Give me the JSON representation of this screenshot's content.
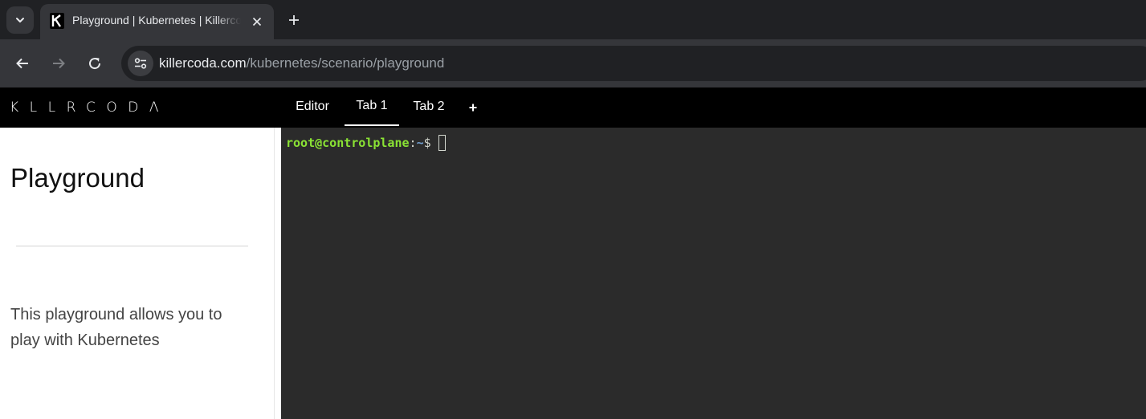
{
  "browser": {
    "tab_title": "Playground | Kubernetes | Killercoda",
    "url_host": "killercoda.com",
    "url_path": "/kubernetes/scenario/playground"
  },
  "header": {
    "logo_text": "KLLRCODΛ",
    "tabs": [
      {
        "label": "Editor"
      },
      {
        "label": "Tab 1"
      },
      {
        "label": "Tab 2"
      }
    ],
    "add_label": "+"
  },
  "sidebar": {
    "title": "Playground",
    "description": "This playground allows you to play with Kubernetes"
  },
  "terminal": {
    "user_host": "root@controlplane",
    "colon": ":",
    "path": "~",
    "sign": "$"
  },
  "colors": {
    "terminal_bg": "#2b2b2b",
    "prompt_user": "#8ae234",
    "prompt_path": "#729fcf"
  },
  "icons": [
    "tab-search-icon",
    "k-favicon-icon",
    "close-icon",
    "plus-icon",
    "back-arrow-icon",
    "forward-arrow-icon",
    "reload-icon",
    "site-settings-icon"
  ]
}
